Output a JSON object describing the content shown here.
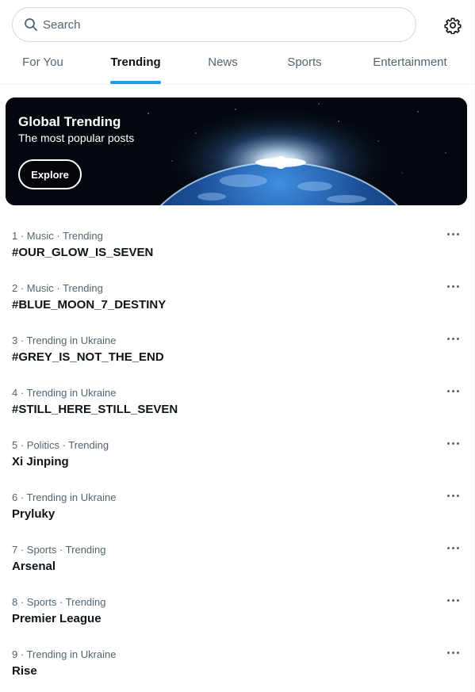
{
  "search": {
    "placeholder": "Search"
  },
  "tabs": [
    {
      "label": "For You",
      "active": false
    },
    {
      "label": "Trending",
      "active": true
    },
    {
      "label": "News",
      "active": false
    },
    {
      "label": "Sports",
      "active": false
    },
    {
      "label": "Entertainment",
      "active": false
    }
  ],
  "banner": {
    "title": "Global Trending",
    "subtitle": "The most popular posts",
    "button_label": "Explore"
  },
  "trends": [
    {
      "meta": "1 · Music · Trending",
      "name": "#OUR_GLOW_IS_SEVEN"
    },
    {
      "meta": "2 · Music · Trending",
      "name": "#BLUE_MOON_7_DESTINY"
    },
    {
      "meta": "3 · Trending in Ukraine",
      "name": "#GREY_IS_NOT_THE_END"
    },
    {
      "meta": "4 · Trending in Ukraine",
      "name": "#STILL_HERE_STILL_SEVEN"
    },
    {
      "meta": "5 · Politics · Trending",
      "name": "Xi Jinping"
    },
    {
      "meta": "6 · Trending in Ukraine",
      "name": "Pryluky"
    },
    {
      "meta": "7 · Sports · Trending",
      "name": "Arsenal"
    },
    {
      "meta": "8 · Sports · Trending",
      "name": "Premier League"
    },
    {
      "meta": "9 · Trending in Ukraine",
      "name": "Rise"
    }
  ],
  "colors": {
    "accent": "#1d9bf0",
    "text": "#0f1419",
    "muted": "#536471",
    "border": "#eff3f4"
  },
  "icons": {
    "search": "search-icon",
    "settings": "gear-icon",
    "more": "more-options-icon"
  }
}
